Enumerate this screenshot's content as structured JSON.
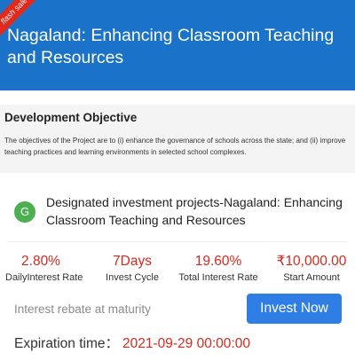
{
  "header": {
    "badge": "flash sale",
    "title": "Nagaland: Enhancing Classroom Teaching and Resources"
  },
  "objective": {
    "title": "Development Objective",
    "text": "The objectives of the Project are to (i) enhance the governance of schools across the state; and (ii) improve teaching practices and learning environments in selected school complexes."
  },
  "project": {
    "avatar_letter": "G",
    "name": "Designated investment projects-Nagaland: Enhancing Classroom Teaching and Resources"
  },
  "stats": [
    {
      "value": "2.80%",
      "label": "DailyInterest Rate"
    },
    {
      "value": "7Days",
      "label": "Invest Cycle"
    },
    {
      "value": "19.60%",
      "label": "Total Interest Rate"
    },
    {
      "value": "₹10,000.00",
      "label": "Start Amount"
    }
  ],
  "rebate_text": "Interest rebate at maturity",
  "invest_button": "Invest Now",
  "expiration": {
    "label": "Expiration time：",
    "value": "2021-09-29 00:00:00"
  },
  "colors": {
    "header_bg": "#1a73c9",
    "accent_red": "#d9281d",
    "button_blue": "#2f7ee6",
    "avatar_green": "#4caf50"
  }
}
